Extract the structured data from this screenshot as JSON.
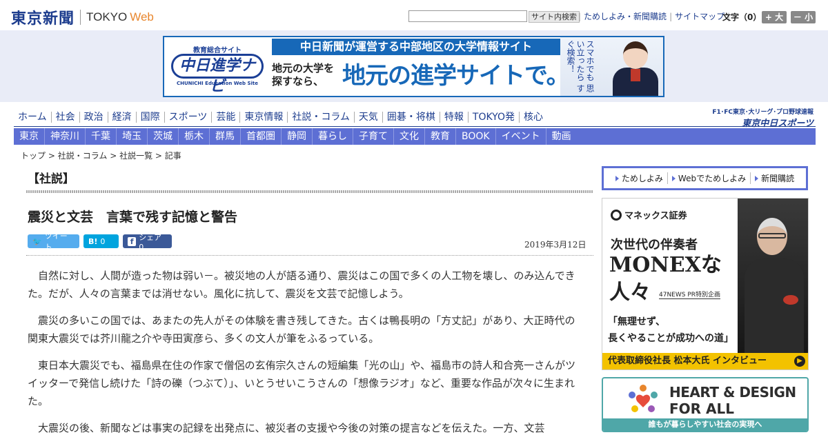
{
  "header": {
    "logo_ja": "東京新聞",
    "logo_en": "TOKYO",
    "logo_web": "Web",
    "search_placeholder": "",
    "search_button": "サイト内検索",
    "links": [
      "ためしよみ・新聞購読",
      "サイトマップ"
    ],
    "font_size_label": "文字（0）",
    "font_up": "+ 大",
    "font_down": "－ 小"
  },
  "banner": {
    "logo_sub": "教育総合サイト",
    "logo_main": "中日進学ナビ",
    "logo_en": "CHUNICHI Education Web Site",
    "top_text": "中日新聞が運営する中部地区の大学情報サイト",
    "left_line1": "地元の大学を",
    "left_line2": "探すなら、",
    "main_text": "地元の進学サイトで。",
    "vertical_text": "スマホでも 思い立ったら すぐ検索！"
  },
  "nav": {
    "items": [
      "ホーム",
      "社会",
      "政治",
      "経済",
      "国際",
      "スポーツ",
      "芸能",
      "東京情報",
      "社説・コラム",
      "天気",
      "囲碁・将棋",
      "特報",
      "TOKYO発",
      "核心"
    ],
    "sports_top": "F1･FC東京･大リーグ･プロ野球速報",
    "sports_main": "東京中日スポーツ"
  },
  "subnav": {
    "items": [
      "東京",
      "神奈川",
      "千葉",
      "埼玉",
      "茨城",
      "栃木",
      "群馬",
      "首都圏",
      "静岡",
      "暮らし",
      "子育て",
      "文化",
      "教育",
      "BOOK",
      "イベント",
      "動画"
    ]
  },
  "breadcrumb": [
    "トップ",
    "社説・コラム",
    "社説一覧",
    "記事"
  ],
  "article": {
    "section": "【社説】",
    "title": "震災と文芸　言葉で残す記憶と警告",
    "date": "2019年3月12日",
    "tweet_label": "ツイート",
    "hatena_label": "0",
    "fb_label": "シェア 0",
    "paragraphs": [
      "自然に対し、人間が造った物は弱い－。被災地の人が語る通り、震災はこの国で多くの人工物を壊し、のみ込んできた。だが、人々の言葉までは消せない。風化に抗して、震災を文芸で記憶しよう。",
      "震災の多いこの国では、あまたの先人がその体験を書き残してきた。古くは鴨長明の「方丈記」があり、大正時代の関東大震災では芥川龍之介や寺田寅彦ら、多くの文人が筆をふるっている。",
      "東日本大震災でも、福島県在住の作家で僧侶の玄侑宗久さんの短編集「光の山」や、福島市の詩人和合亮一さんがツイッターで発信し続けた「詩の礫（つぶて）」、いとうせいこうさんの「想像ラジオ」など、重要な作品が次々に生まれた。",
      "大震災の後、新聞などは事実の記録を出発点に、被災者の支援や今後の対策の提言などを伝えた。一方、文芸"
    ]
  },
  "sidebar": {
    "menu": [
      "ためしよみ",
      "Webでためしよみ",
      "新聞購読"
    ],
    "monex": {
      "logo": "マネックス証券",
      "headline1": "次世代の伴奏者",
      "headline2": "MONEXな",
      "headline3": "人々",
      "pr": "47NEWS PR特別企画",
      "quote1": "「無理せず、",
      "quote2": "長くやることが成功への道」",
      "bottom": "代表取締役社長 松本大氏 インタビュー"
    },
    "hd": {
      "line1": "HEART & DESIGN",
      "line2": "FOR ALL",
      "bottom": "誰もが暮らしやすい社会の実現へ"
    }
  }
}
